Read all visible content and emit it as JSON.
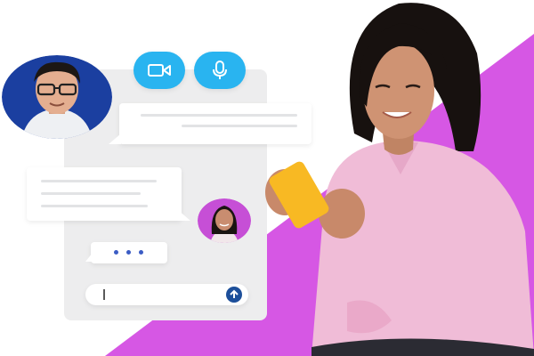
{
  "colors": {
    "accent_purple": "#d657e4",
    "action_blue": "#29b4f0",
    "send_blue": "#1d4f9a",
    "typing_blue": "#3b5cc4",
    "panel_gray": "#ededee",
    "bubble_line": "#e2e3e5"
  },
  "icons": {
    "video": "video-camera-icon",
    "mic": "microphone-icon",
    "send": "arrow-up-icon"
  },
  "chat": {
    "input_value": "",
    "typing_indicator": "three-dots"
  }
}
